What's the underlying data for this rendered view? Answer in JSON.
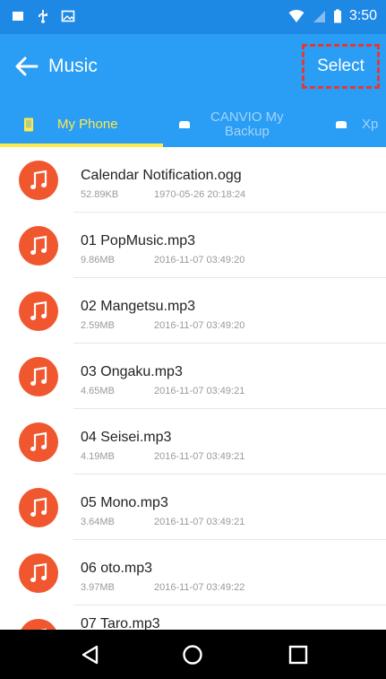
{
  "status_bar": {
    "time": "3:50",
    "left_icons": [
      "notification-square-icon",
      "usb-icon",
      "image-icon"
    ],
    "right_icons": [
      "wifi-icon",
      "signal-icon",
      "battery-icon"
    ]
  },
  "app_bar": {
    "back_icon": "arrow-left-icon",
    "title": "Music",
    "select_label": "Select"
  },
  "tabs": [
    {
      "label": "My Phone",
      "icon": "phone-icon",
      "active": true
    },
    {
      "label": "CANVIO My\nBackup",
      "icon": "drive-icon",
      "active": false
    },
    {
      "label": "Xp",
      "icon": "drive-icon",
      "active": false
    }
  ],
  "files": [
    {
      "name": "Calendar Notification.ogg",
      "size": "52.89KB",
      "date": "1970-05-26 20:18:24"
    },
    {
      "name": "01 PopMusic.mp3",
      "size": "9.86MB",
      "date": "2016-11-07 03:49:20"
    },
    {
      "name": "02 Mangetsu.mp3",
      "size": "2.59MB",
      "date": "2016-11-07 03:49:20"
    },
    {
      "name": "03 Ongaku.mp3",
      "size": "4.65MB",
      "date": "2016-11-07 03:49:21"
    },
    {
      "name": "04 Seisei.mp3",
      "size": "4.19MB",
      "date": "2016-11-07 03:49:21"
    },
    {
      "name": "05 Mono.mp3",
      "size": "3.64MB",
      "date": "2016-11-07 03:49:21"
    },
    {
      "name": "06 oto.mp3",
      "size": "3.97MB",
      "date": "2016-11-07 03:49:22"
    },
    {
      "name": "07 Taro.mp3",
      "size": "",
      "date": ""
    }
  ],
  "file_icon": "music-note-icon",
  "nav_bar": [
    "back-triangle-icon",
    "home-circle-icon",
    "recents-square-icon"
  ],
  "colors": {
    "status_bar": "#1e88e5",
    "app_bar": "#2a9df4",
    "tab_active": "#ffe94d",
    "file_icon_bg": "#f0572f",
    "select_highlight": "#e53935"
  }
}
